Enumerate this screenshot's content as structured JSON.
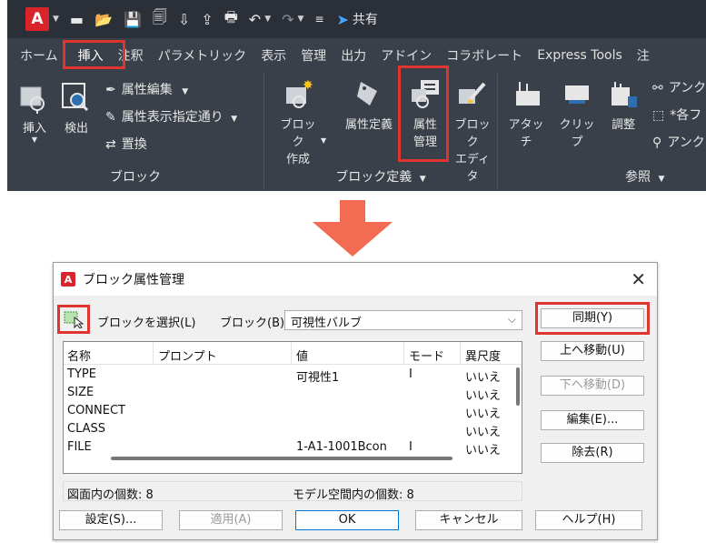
{
  "ribbon": {
    "app_letter": "A",
    "share_label": "共有",
    "tabs": [
      "ホーム",
      "挿入",
      "注釈",
      "パラメトリック",
      "表示",
      "管理",
      "出力",
      "アドイン",
      "コラボレート",
      "Express Tools",
      "注"
    ],
    "active_tab_index": 1,
    "block_panel": {
      "title": "ブロック",
      "insert_label": "挿入",
      "detect_label": "検出",
      "attr_edit_label": "属性編集",
      "attr_display_label": "属性表示指定通り",
      "replace_label": "置換"
    },
    "block_def_panel": {
      "title": "ブロック定義",
      "create_label_1": "ブロック",
      "create_label_2": "作成",
      "attr_define_label": "属性定義",
      "attr_manage_label_1": "属性",
      "attr_manage_label_2": "管理",
      "block_editor_label_1": "ブロック",
      "block_editor_label_2": "エディタ"
    },
    "reference_panel": {
      "title": "参照",
      "attach_label": "アタッチ",
      "clip_label": "クリップ",
      "adjust_label": "調整",
      "underlay_label": "アンク",
      "items_label": "*各フ",
      "underlay2_label": "アンク"
    }
  },
  "dialog": {
    "app_letter": "A",
    "title": "ブロック属性管理",
    "select_block_label": "ブロックを選択(L)",
    "block_label": "ブロック(B):",
    "block_value": "可視性バルブ",
    "columns": [
      "名称",
      "プロンプト",
      "値",
      "モード",
      "異尺度"
    ],
    "rows": [
      {
        "name": "TYPE",
        "prompt": "",
        "value": "可視性1",
        "mode": "I",
        "annotative": "いいえ"
      },
      {
        "name": "SIZE",
        "prompt": "",
        "value": "",
        "mode": "",
        "annotative": "いいえ"
      },
      {
        "name": "CONNECT",
        "prompt": "",
        "value": "",
        "mode": "",
        "annotative": "いいえ"
      },
      {
        "name": "CLASS",
        "prompt": "",
        "value": "",
        "mode": "",
        "annotative": "いいえ"
      },
      {
        "name": "FILE",
        "prompt": "",
        "value": "1-A1-1001Bcon",
        "mode": "I",
        "annotative": "いいえ"
      }
    ],
    "count_in_drawing": "図面内の個数: 8",
    "count_in_model": "モデル空間内の個数: 8",
    "sync_label": "同期(Y)",
    "move_up_label": "上へ移動(U)",
    "move_down_label": "下へ移動(D)",
    "edit_label": "編集(E)...",
    "remove_label": "除去(R)",
    "settings_label": "設定(S)...",
    "apply_label": "適用(A)",
    "ok_label": "OK",
    "cancel_label": "キャンセル",
    "help_label": "ヘルプ(H)"
  },
  "colors": {
    "highlight": "#e0342f",
    "ribbon_bg": "#3a4049",
    "arrow": "#f26b52"
  }
}
